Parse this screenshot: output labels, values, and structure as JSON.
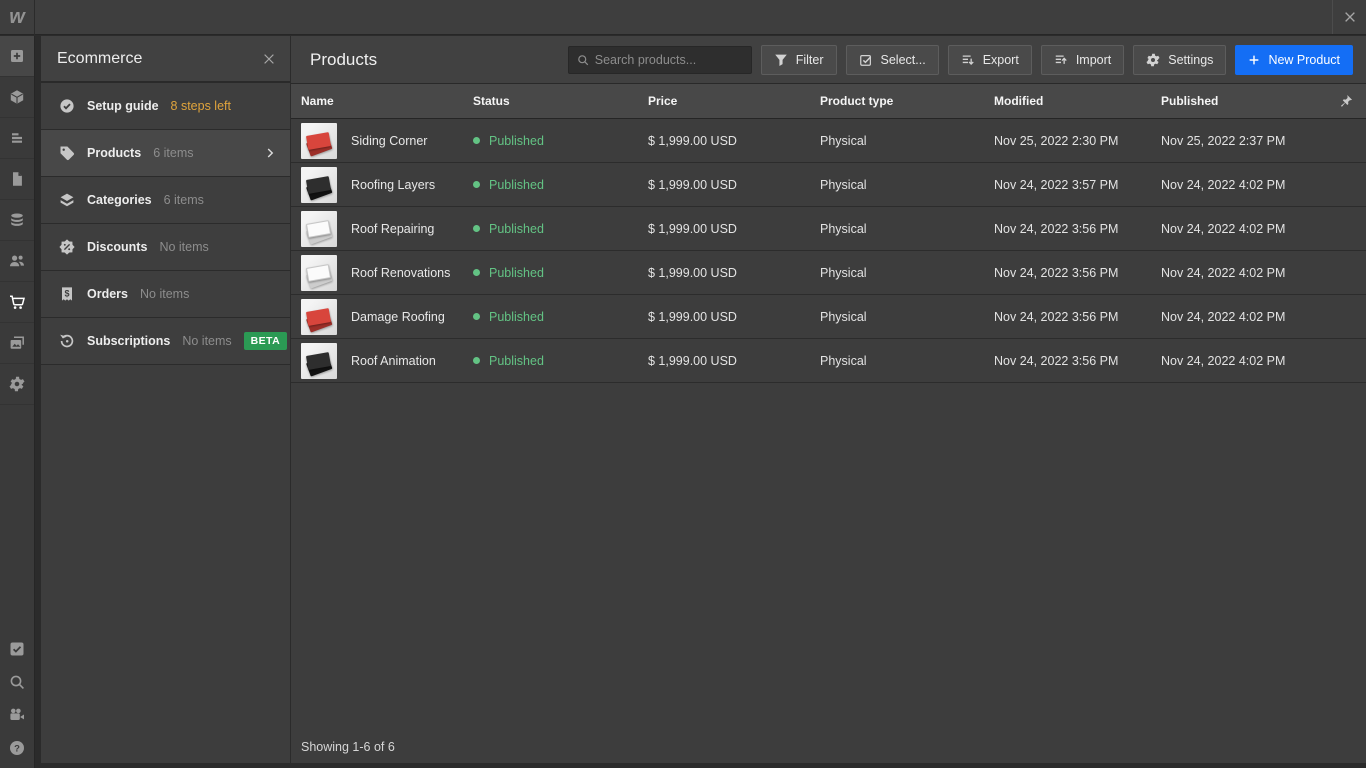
{
  "topbar": {
    "logo": "w"
  },
  "rail": {
    "top": [
      {
        "name": "add-element",
        "icon": "plus-box",
        "raised": true
      },
      {
        "name": "components",
        "icon": "cube"
      },
      {
        "name": "navigator",
        "icon": "navigator"
      },
      {
        "name": "pages",
        "icon": "page"
      },
      {
        "name": "cms",
        "icon": "database"
      },
      {
        "name": "users",
        "icon": "users"
      },
      {
        "name": "ecommerce",
        "icon": "cart",
        "active": true
      },
      {
        "name": "assets",
        "icon": "assets"
      },
      {
        "name": "settings",
        "icon": "gear"
      }
    ],
    "bottom": [
      {
        "name": "audit",
        "icon": "check-square"
      },
      {
        "name": "search",
        "icon": "magnifier"
      },
      {
        "name": "video-tutorials",
        "icon": "video"
      },
      {
        "name": "help",
        "icon": "help"
      }
    ]
  },
  "sidebar": {
    "title": "Ecommerce",
    "items": [
      {
        "label": "Setup guide",
        "meta": "8 steps left",
        "icon": "check-circle",
        "meta_style": "warning"
      },
      {
        "label": "Products",
        "meta": "6 items",
        "icon": "tag",
        "active": true,
        "chevron": true
      },
      {
        "label": "Categories",
        "meta": "6 items",
        "icon": "categories"
      },
      {
        "label": "Discounts",
        "meta": "No items",
        "icon": "discount"
      },
      {
        "label": "Orders",
        "meta": "No items",
        "icon": "orders"
      },
      {
        "label": "Subscriptions",
        "meta": "No items",
        "icon": "subscriptions",
        "badge": "BETA"
      }
    ]
  },
  "main": {
    "title": "Products",
    "search": {
      "placeholder": "Search products...",
      "value": ""
    },
    "toolbar": [
      {
        "label": "Filter",
        "icon": "funnel"
      },
      {
        "label": "Select...",
        "icon": "select-box"
      },
      {
        "label": "Export",
        "icon": "export"
      },
      {
        "label": "Import",
        "icon": "import"
      },
      {
        "label": "Settings",
        "icon": "gear"
      }
    ],
    "new_product_label": "New Product",
    "table": {
      "columns": [
        "Name",
        "Status",
        "Price",
        "Product type",
        "Modified",
        "Published"
      ],
      "rows": [
        {
          "name": "Siding Corner",
          "thumb": "red",
          "status": "Published",
          "price": "$ 1,999.00 USD",
          "type": "Physical",
          "modified": "Nov 25, 2022 2:30 PM",
          "published": "Nov 25, 2022 2:37 PM"
        },
        {
          "name": "Roofing Layers",
          "thumb": "black",
          "status": "Published",
          "price": "$ 1,999.00 USD",
          "type": "Physical",
          "modified": "Nov 24, 2022 3:57 PM",
          "published": "Nov 24, 2022 4:02 PM"
        },
        {
          "name": "Roof Repairing",
          "thumb": "white",
          "status": "Published",
          "price": "$ 1,999.00 USD",
          "type": "Physical",
          "modified": "Nov 24, 2022 3:56 PM",
          "published": "Nov 24, 2022 4:02 PM"
        },
        {
          "name": "Roof Renovations",
          "thumb": "white",
          "status": "Published",
          "price": "$ 1,999.00 USD",
          "type": "Physical",
          "modified": "Nov 24, 2022 3:56 PM",
          "published": "Nov 24, 2022 4:02 PM"
        },
        {
          "name": "Damage Roofing",
          "thumb": "red",
          "status": "Published",
          "price": "$ 1,999.00 USD",
          "type": "Physical",
          "modified": "Nov 24, 2022 3:56 PM",
          "published": "Nov 24, 2022 4:02 PM"
        },
        {
          "name": "Roof Animation",
          "thumb": "black",
          "status": "Published",
          "price": "$ 1,999.00 USD",
          "type": "Physical",
          "modified": "Nov 24, 2022 3:56 PM",
          "published": "Nov 24, 2022 4:02 PM"
        }
      ]
    },
    "footer": "Showing 1-6 of 6"
  },
  "colors": {
    "accent_blue": "#146ef5",
    "published_green": "#63c384",
    "beta_green": "#2b9a54",
    "warning_orange": "#e0a43c"
  }
}
